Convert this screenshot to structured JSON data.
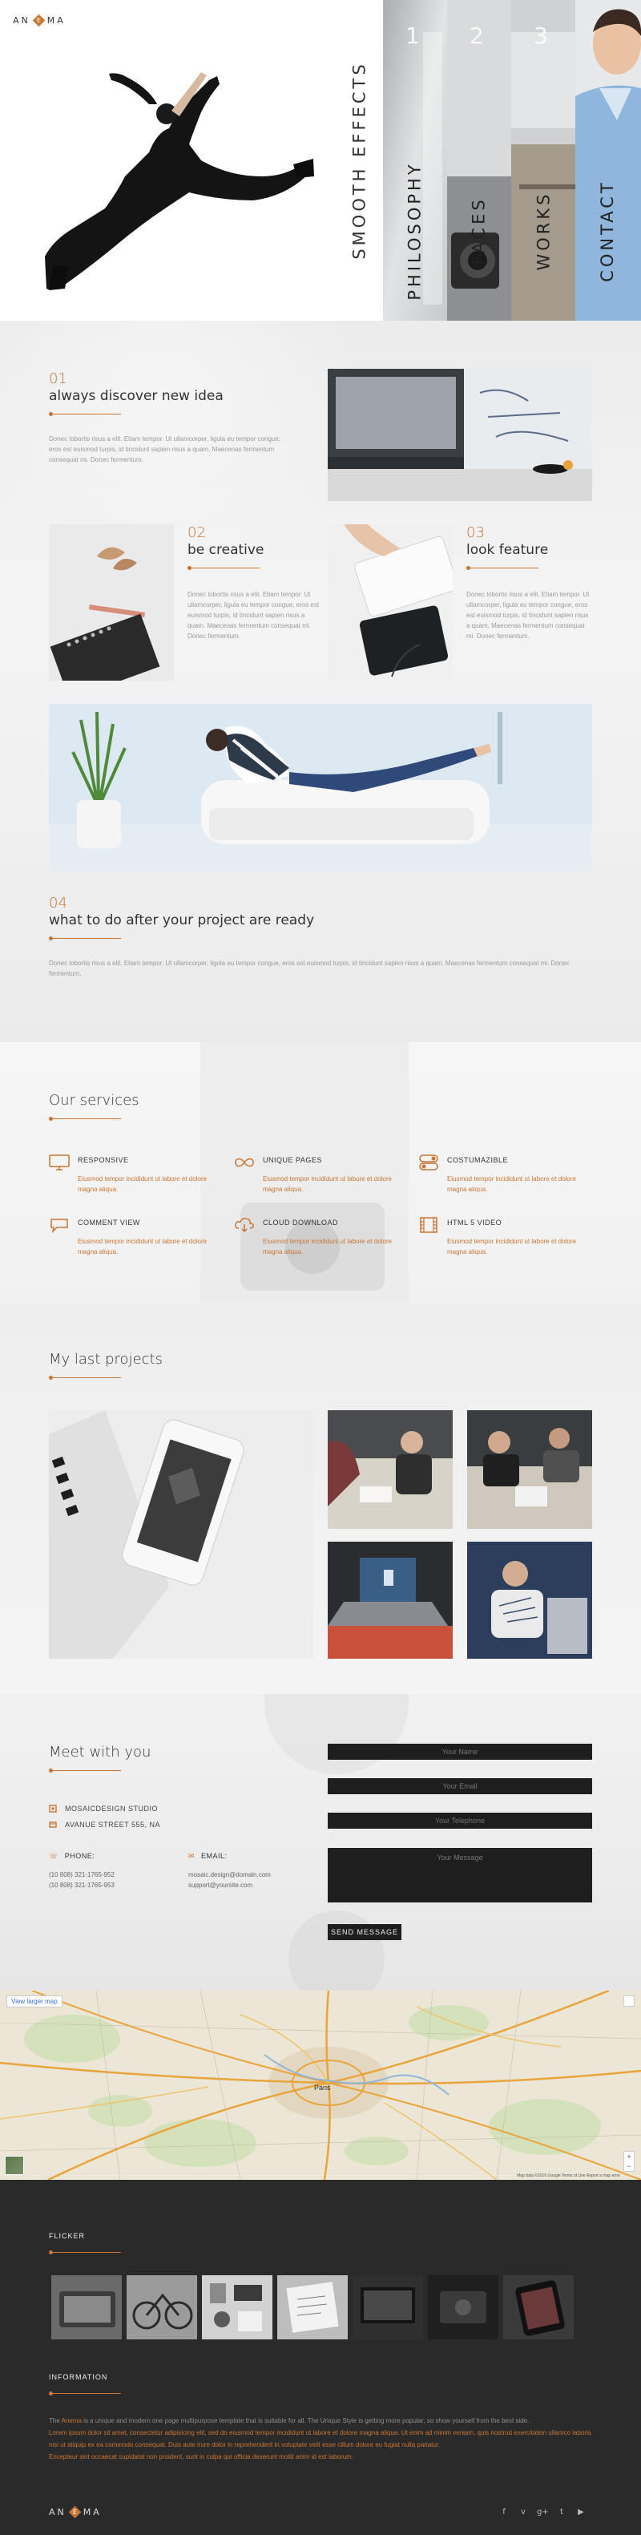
{
  "brand": {
    "logo_left": "AN",
    "logo_mark": "E",
    "logo_right": "MA",
    "accent_color": "#c87533"
  },
  "hero": {
    "tagline": "SMOOTH EFFECTS",
    "panels": [
      {
        "num": "1",
        "label": "PHILOSOPHY"
      },
      {
        "num": "2",
        "label": "FACES"
      },
      {
        "num": "3",
        "label": "WORKS"
      },
      {
        "num": "",
        "label": "CONTACT"
      }
    ]
  },
  "features": [
    {
      "num": "01",
      "title": "always discover new idea",
      "text": "Donec lobortis risus a elit. Etiam tempor. Ut ullamcorper, ligula eu tempor congue, eros est euismod turpis, id tincidunt sapien risus a quam. Maecenas fermentum consequat mi. Donec fermentum."
    },
    {
      "num": "02",
      "title": "be creative",
      "text": "Donec lobortis risus a elit. Etiam tempor. Ut ullamcorper, ligula eu tempor congue, eros est euismod turpis, id tincidunt sapien risus a quam. Maecenas fermentum consequat mi. Donec fermentum."
    },
    {
      "num": "03",
      "title": "look feature",
      "text": "Donec lobortis risus a elit. Etiam tempor. Ut ullamcorper, ligula eu tempor congue, eros est euismod turpis, id tincidunt sapien risus a quam. Maecenas fermentum consequat mi. Donec fermentum."
    },
    {
      "num": "04",
      "title": "what to do after your project are ready",
      "text": "Donec lobortis risus a elit. Etiam tempor. Ut ullamcorper, ligula eu tempor congue, eros est euismod turpis, id tincidunt sapien risus a quam. Maecenas fermentum consequat mi. Donec fermentum."
    }
  ],
  "services": {
    "title": "Our services",
    "items": [
      {
        "title": "RESPONSIVE",
        "text": "Eiusmod tempor incididunt ut labore et dolore magna aliqua.",
        "icon": "monitor-icon"
      },
      {
        "title": "UNIQUE PAGES",
        "text": "Eiusmod tempor incididunt ut labore et dolore magna aliqua.",
        "icon": "infinity-icon"
      },
      {
        "title": "COSTUMAZIBLE",
        "text": "Eiusmod tempor incididunt ut labore et dolore magna aliqua.",
        "icon": "toggles-icon"
      },
      {
        "title": "COMMENT VIEW",
        "text": "Eiusmod tempor incididunt ut labore et dolore magna aliqua.",
        "icon": "speech-bubble-icon"
      },
      {
        "title": "CLOUD DOWNLOAD",
        "text": "Eiusmod tempor incididunt ut labore et dolore magna aliqua.",
        "icon": "cloud-download-icon"
      },
      {
        "title": "HTML 5 VIDEO",
        "text": "Eiusmod tempor incididunt ut labore et dolore magna aliqua.",
        "icon": "film-icon"
      }
    ]
  },
  "projects": {
    "title": "My last projects"
  },
  "contact": {
    "title": "Meet with you",
    "company": "MOSAICDESIGN STUDIO",
    "address": "AVANUE STREET 555, NA",
    "phone_label": "PHONE:",
    "phones": [
      "(10 808) 321-1765-952",
      "(10 808) 321-1765-953"
    ],
    "email_label": "EMAIL:",
    "emails": [
      "mosaic.design@domain.com",
      "support@yoursite.com"
    ],
    "form": {
      "name": "Your Name",
      "email": "Your Email",
      "phone": "Your Telephone",
      "message": "Your Message",
      "send": "SEND MESSAGE"
    }
  },
  "map": {
    "button": "View larger map",
    "city": "Paris",
    "credit": "Map data ©2016 Google  Terms of Use  Report a map error"
  },
  "footer": {
    "flicker_title": "FLICKER",
    "info_title": "INFORMATION",
    "info_p1_prefix": "The ",
    "info_brand": "Anema",
    "info_p1_suffix": " is a unique and modern one page multipurpose template that is suitable for all. The Unique Style is getting more popular, so show yourself from the best side.",
    "info_p2": "Lorem ipsum dolor sit amet, consectetur adipisicing elit, sed do eiusmod tempor incididunt ut labore et dolore magna aliqua. Ut enim ad minim veniam, quis nostrud exercitation ullamco laboris nisi ut aliquip ex ea commodo consequat. Duis aute irure dolor in reprehenderit in voluptate velit esse cillum dolore eu fugiat nulla pariatur.",
    "info_p3": "Excepteur sint occaecat cupidatat non proident, sunt in culpa qui officia deserunt mollit anim id est laborum.",
    "social": [
      "f",
      "v",
      "g+",
      "t",
      "▶"
    ]
  }
}
